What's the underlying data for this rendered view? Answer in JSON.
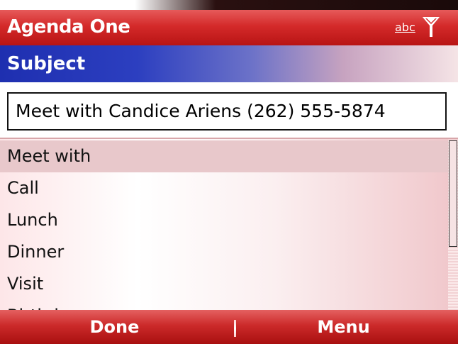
{
  "app": {
    "title": "Agenda One",
    "input_mode": "abc"
  },
  "header": {
    "label": "Subject"
  },
  "subject_field": {
    "value": "Meet with Candice Ariens (262) 555-5874"
  },
  "suggestions": {
    "items": [
      {
        "label": "Meet with",
        "selected": true
      },
      {
        "label": "Call",
        "selected": false
      },
      {
        "label": "Lunch",
        "selected": false
      },
      {
        "label": "Dinner",
        "selected": false
      },
      {
        "label": "Visit",
        "selected": false
      },
      {
        "label": "Birthday",
        "selected": false
      }
    ]
  },
  "softkeys": {
    "left": "Done",
    "right": "Menu"
  },
  "icons": {
    "signal": "signal-strength-icon"
  },
  "colors": {
    "title_bar": "#d42a2a",
    "header_start": "#1e2fb0",
    "softkey_bar": "#cc2a2a",
    "selection": "#e8c8cb"
  }
}
